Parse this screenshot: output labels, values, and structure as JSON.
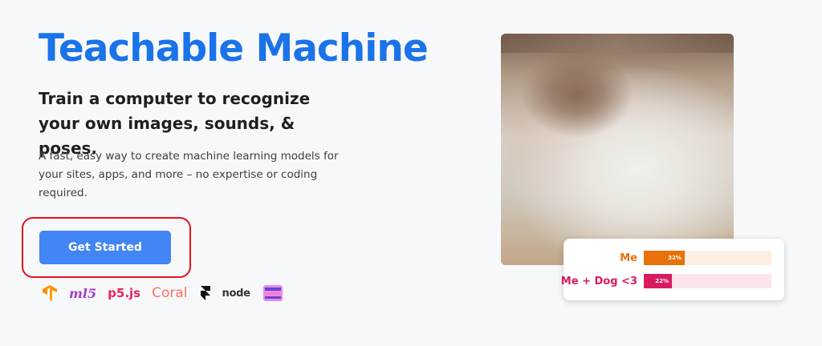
{
  "hero": {
    "title": "Teachable Machine",
    "subtitle": "Train a computer to recognize your own images, sounds, & poses.",
    "description": "A fast, easy way to create machine learning models for your sites, apps, and more – no expertise or coding required.",
    "cta_label": "Get Started"
  },
  "logos": {
    "ml5": "ml5",
    "p5": "p5.js",
    "coral": "Coral",
    "node": "node"
  },
  "demo": {
    "classes": [
      {
        "label": "Me",
        "percent": "32%",
        "value": 0.32,
        "color": "#e8710a",
        "track": "#fdeee2"
      },
      {
        "label": "Me + Dog <3",
        "percent": "22%",
        "value": 0.22,
        "color": "#d81b60",
        "track": "#fbe4ec"
      }
    ]
  },
  "colors": {
    "brand": "#1a73e8",
    "button": "#4285f4",
    "highlight": "#e0141f"
  }
}
